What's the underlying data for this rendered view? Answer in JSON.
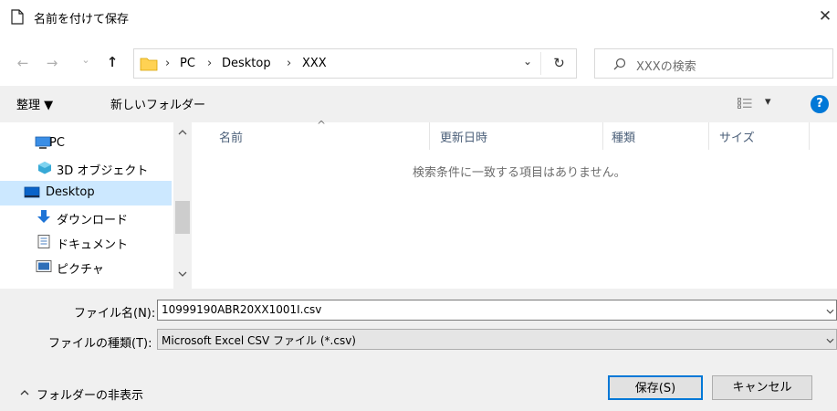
{
  "window": {
    "title": "名前を付けて保存",
    "close_glyph": "✕"
  },
  "nav": {
    "back_glyph": "←",
    "forward_glyph": "→",
    "recent_glyph": "⌄",
    "up_glyph": "↑",
    "breadcrumbs": [
      "PC",
      "Desktop",
      "XXX"
    ],
    "separator": "›",
    "dropdown_glyph": "⌄",
    "refresh_glyph": "↻",
    "search_placeholder": "XXXの検索"
  },
  "toolbar": {
    "organize_label": "整理 ▼",
    "new_folder_label": "新しいフォルダー",
    "view_dropdown_glyph": "▾",
    "help_glyph": "?"
  },
  "sidebar": {
    "items": [
      {
        "label": "PC",
        "icon": "pc-icon"
      },
      {
        "label": "3D オブジェクト",
        "icon": "3d-objects-icon"
      },
      {
        "label": "Desktop",
        "icon": "desktop-icon",
        "selected": true
      },
      {
        "label": "ダウンロード",
        "icon": "download-icon"
      },
      {
        "label": "ドキュメント",
        "icon": "documents-icon"
      },
      {
        "label": "ピクチャ",
        "icon": "pictures-icon"
      }
    ]
  },
  "list": {
    "columns": [
      "名前",
      "更新日時",
      "種類",
      "サイズ"
    ],
    "empty_message": "検索条件に一致する項目はありません。",
    "sort_glyph": "^"
  },
  "form": {
    "filename_label": "ファイル名(N):",
    "filename_value": "10999190ABR20XX1001I.csv",
    "filetype_label": "ファイルの種類(T):",
    "filetype_value": "Microsoft Excel CSV ファイル (*.csv)",
    "hide_folders_label": "フォルダーの非表示",
    "save_label": "保存(S)",
    "cancel_label": "キャンセル"
  },
  "colors": {
    "accent": "#0078d7",
    "selection": "#cce8ff",
    "folder": "#ffd253"
  }
}
